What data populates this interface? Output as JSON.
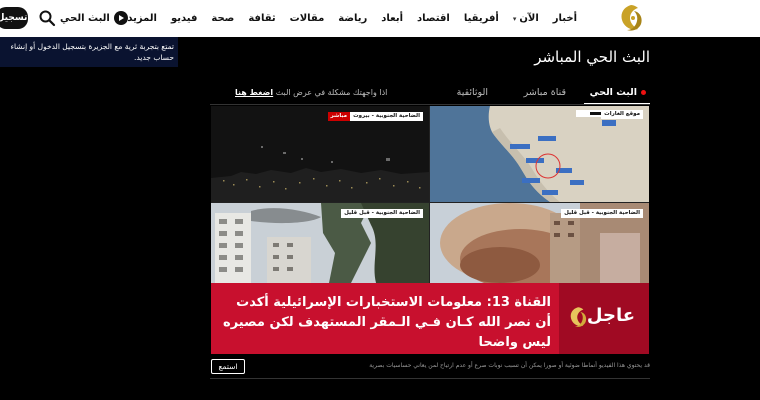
{
  "nav": {
    "items": [
      "أخبار",
      "الآن",
      "أفريقيا",
      "اقتصاد",
      "أبعاد",
      "رياضة",
      "مقالات",
      "ثقافة",
      "صحة",
      "فيديو",
      "المزيد"
    ],
    "live": "البث الحي",
    "login": "تسجيل"
  },
  "tooltip": "تمتع بتجربة ثرية مع الجزيرة بتسجيل الدخول أو إنشاء حساب جديد.",
  "page_title": "البث الحي المباشر",
  "tabs": {
    "live": "البث الحي",
    "mubasher": "قناة مباشر",
    "doc": "الوثائقية"
  },
  "problem": {
    "text": "اذا واجهتك مشكلة في عرض البث",
    "link": "اضغط هنا"
  },
  "video": {
    "labels": {
      "q1_w": "الضاحية الجنوبية - بيروت",
      "q1_r": "مباشر",
      "q2": "موقع الغارات",
      "q3": "الضاحية الجنوبية - قبل قليل",
      "q4": "الضاحية الجنوبية - قبل قليل"
    },
    "breaking_word": "عاجل",
    "breaking_text": "القناة 13: معلومات الاستخبارات الإسرائيلية أكدت أن نصر الله كـان فـي الـمقر المستهدف لكن مصيره ليس واضحا"
  },
  "listen": "استمع",
  "warning": "قد يحتوي هذا الفيديو أنماطا ضوئية أو صورا يمكن أن تسبب نوبات صرع أو عدم ارتياح لمن يعاني حساسيات بصرية",
  "colors": {
    "breaking_red": "#c8102e",
    "live_dot": "#e11111"
  }
}
